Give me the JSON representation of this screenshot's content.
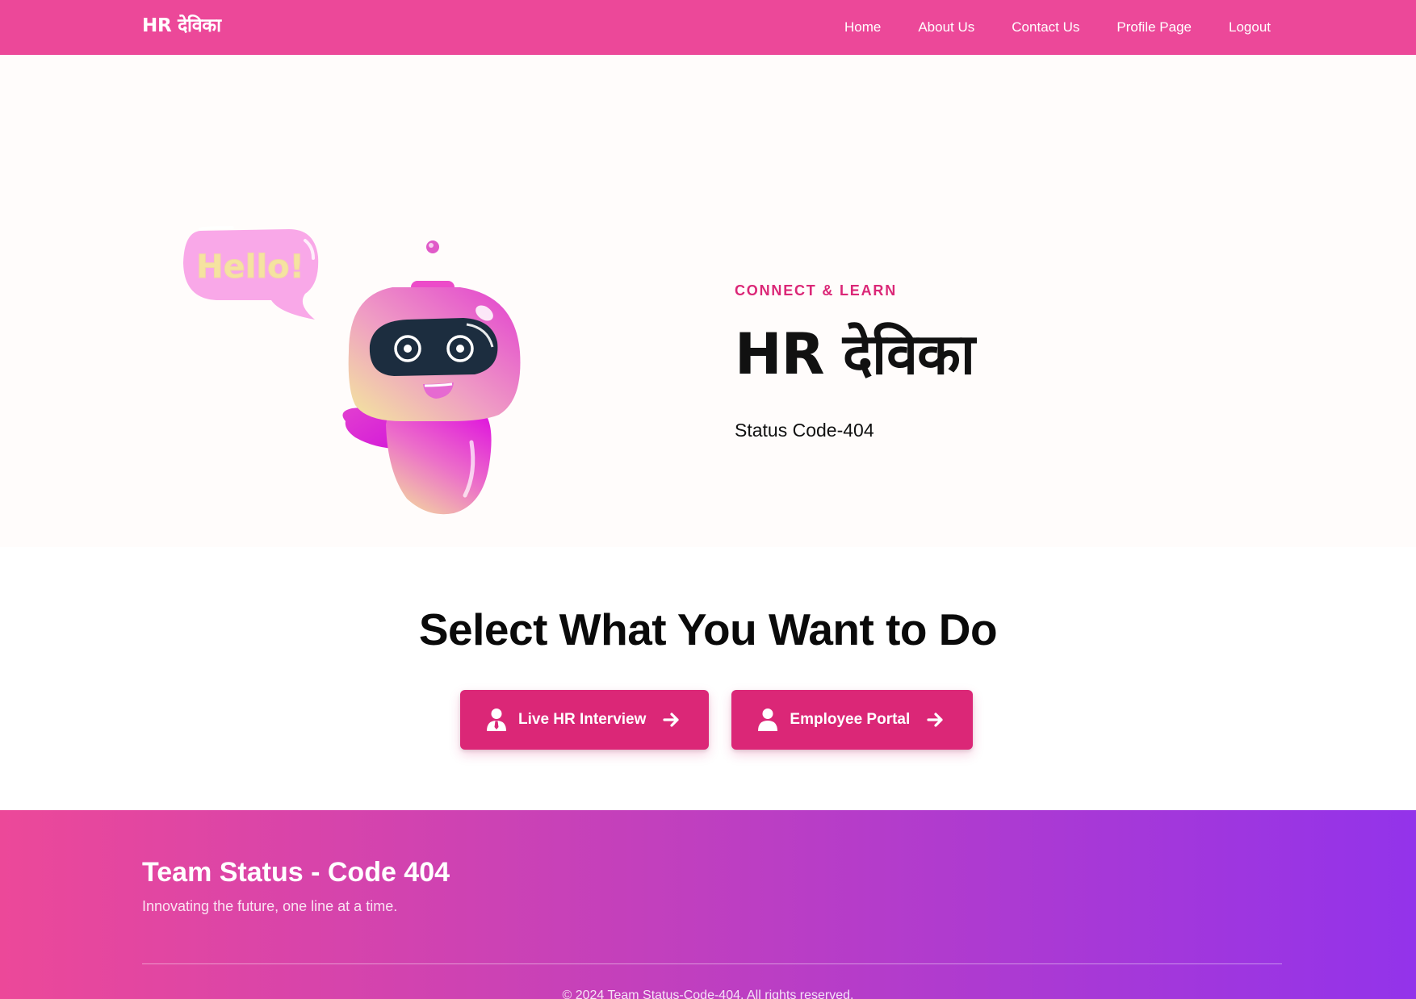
{
  "nav": {
    "brand": "HR देविका",
    "links": [
      "Home",
      "About Us",
      "Contact Us",
      "Profile Page",
      "Logout"
    ]
  },
  "hero": {
    "eyebrow": "CONNECT & LEARN",
    "title": "HR देविका",
    "subtitle": "Status Code-404",
    "illustration": {
      "speech_bubble_text": "Hello!"
    }
  },
  "select": {
    "title": "Select What You Want to Do",
    "buttons": [
      {
        "label": "Live HR Interview",
        "icon": "person-tie-icon",
        "trailing_icon": "arrow-right-icon"
      },
      {
        "label": "Employee Portal",
        "icon": "user-icon",
        "trailing_icon": "arrow-right-icon"
      }
    ]
  },
  "footer": {
    "title": "Team Status - Code 404",
    "tagline": "Innovating the future, one line at a time.",
    "copyright": "© 2024 Team Status-Code-404. All rights reserved."
  },
  "colors": {
    "nav_bg": "#ec4899",
    "accent": "#db2777",
    "footer_gradient_start": "#ec4899",
    "footer_gradient_end": "#9333ea",
    "hero_bg": "#fffcfb"
  }
}
